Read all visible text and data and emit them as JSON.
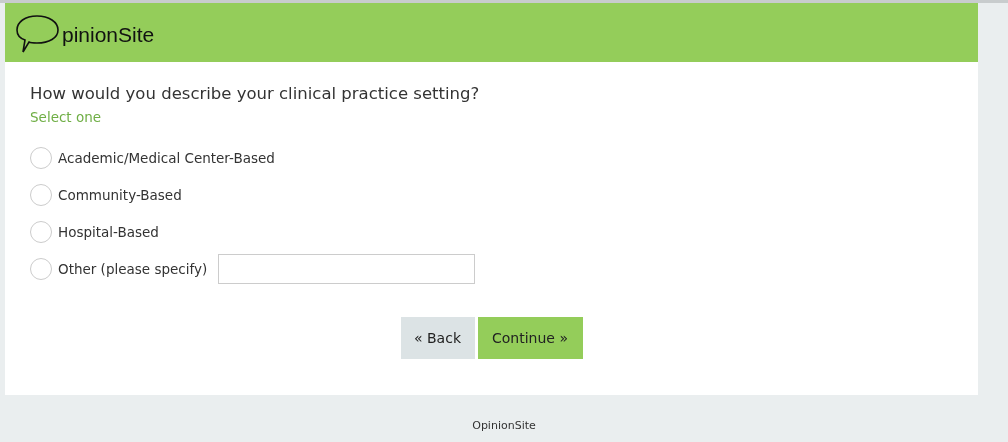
{
  "header": {
    "logo_text": "pinionSite"
  },
  "question": {
    "title": "How would you describe your clinical practice setting?",
    "instruction": "Select one"
  },
  "options": [
    {
      "kind": "plain",
      "label": "Academic/Medical Center-Based",
      "selected": false
    },
    {
      "kind": "plain",
      "label": "Community-Based",
      "selected": false
    },
    {
      "kind": "plain",
      "label": "Hospital-Based",
      "selected": false
    },
    {
      "kind": "other",
      "label": "Other (please specify)",
      "selected": false
    }
  ],
  "buttons": [
    {
      "kind": "back",
      "label": "« Back"
    },
    {
      "kind": "next",
      "label": "Continue »"
    }
  ],
  "footer": {
    "text": "OpinionSite"
  }
}
